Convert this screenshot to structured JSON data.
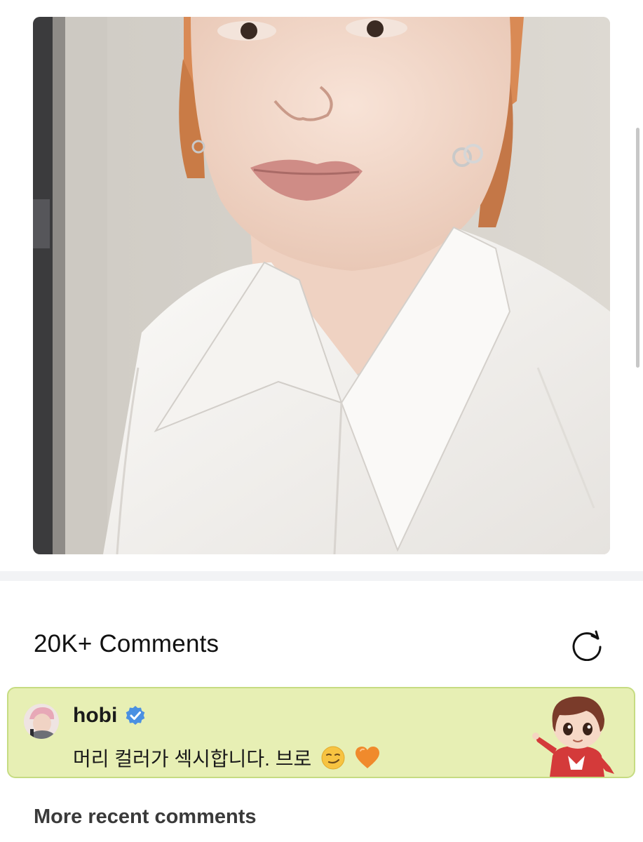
{
  "post": {
    "photo_alt": "selfie-photo"
  },
  "comments": {
    "count_label": "20K+ Comments",
    "refresh_icon": "refresh-icon",
    "pinned": {
      "author": "hobi",
      "verified_icon": "verified-badge-icon",
      "text": "머리 컬러가 섹시합니다. 브로",
      "emojis": [
        "smirk-emoji",
        "orange-heart-emoji"
      ],
      "sticker_icon": "character-sticker",
      "card_bg": "#e7efb4",
      "card_border": "#c6dc82"
    },
    "more_recent_label": "More recent comments"
  },
  "colors": {
    "verified_blue": "#4a90e2",
    "divider": "#f2f3f5"
  }
}
